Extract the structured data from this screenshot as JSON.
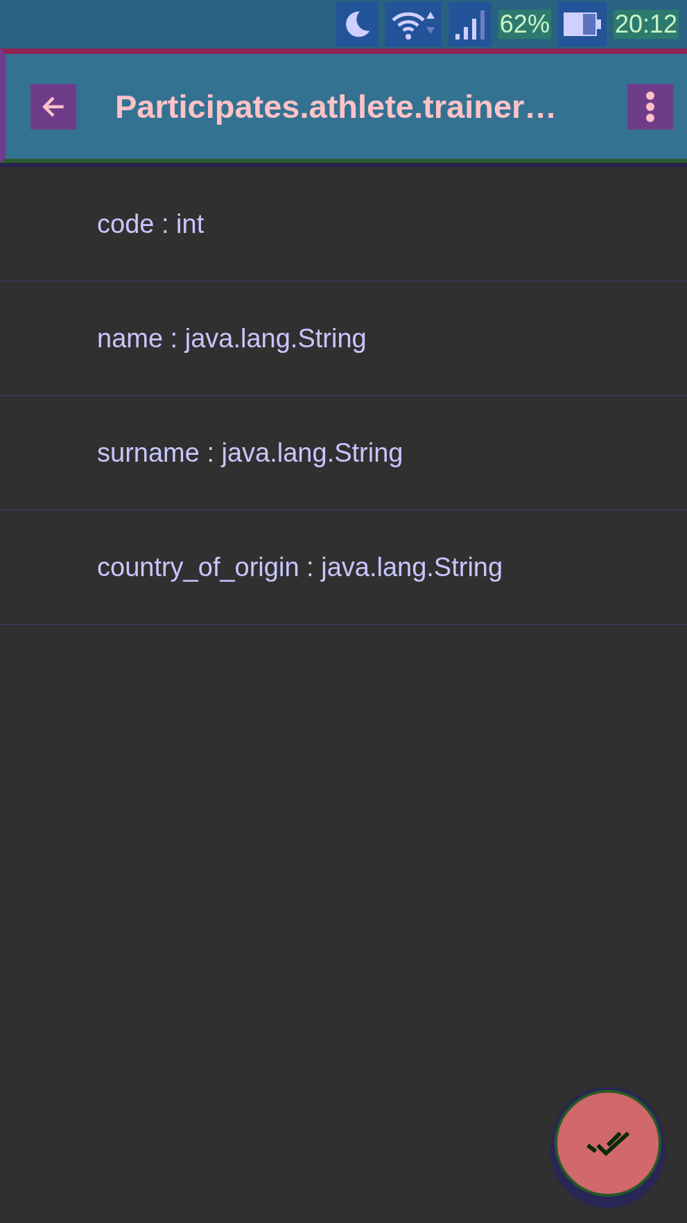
{
  "status_bar": {
    "battery_text": "62%",
    "time": "20:12"
  },
  "app_bar": {
    "title": "Participates.athlete.trainer…"
  },
  "fields": [
    {
      "label": "code : int"
    },
    {
      "label": "name : java.lang.String"
    },
    {
      "label": "surname : java.lang.String"
    },
    {
      "label": "country_of_origin : java.lang.String"
    }
  ]
}
